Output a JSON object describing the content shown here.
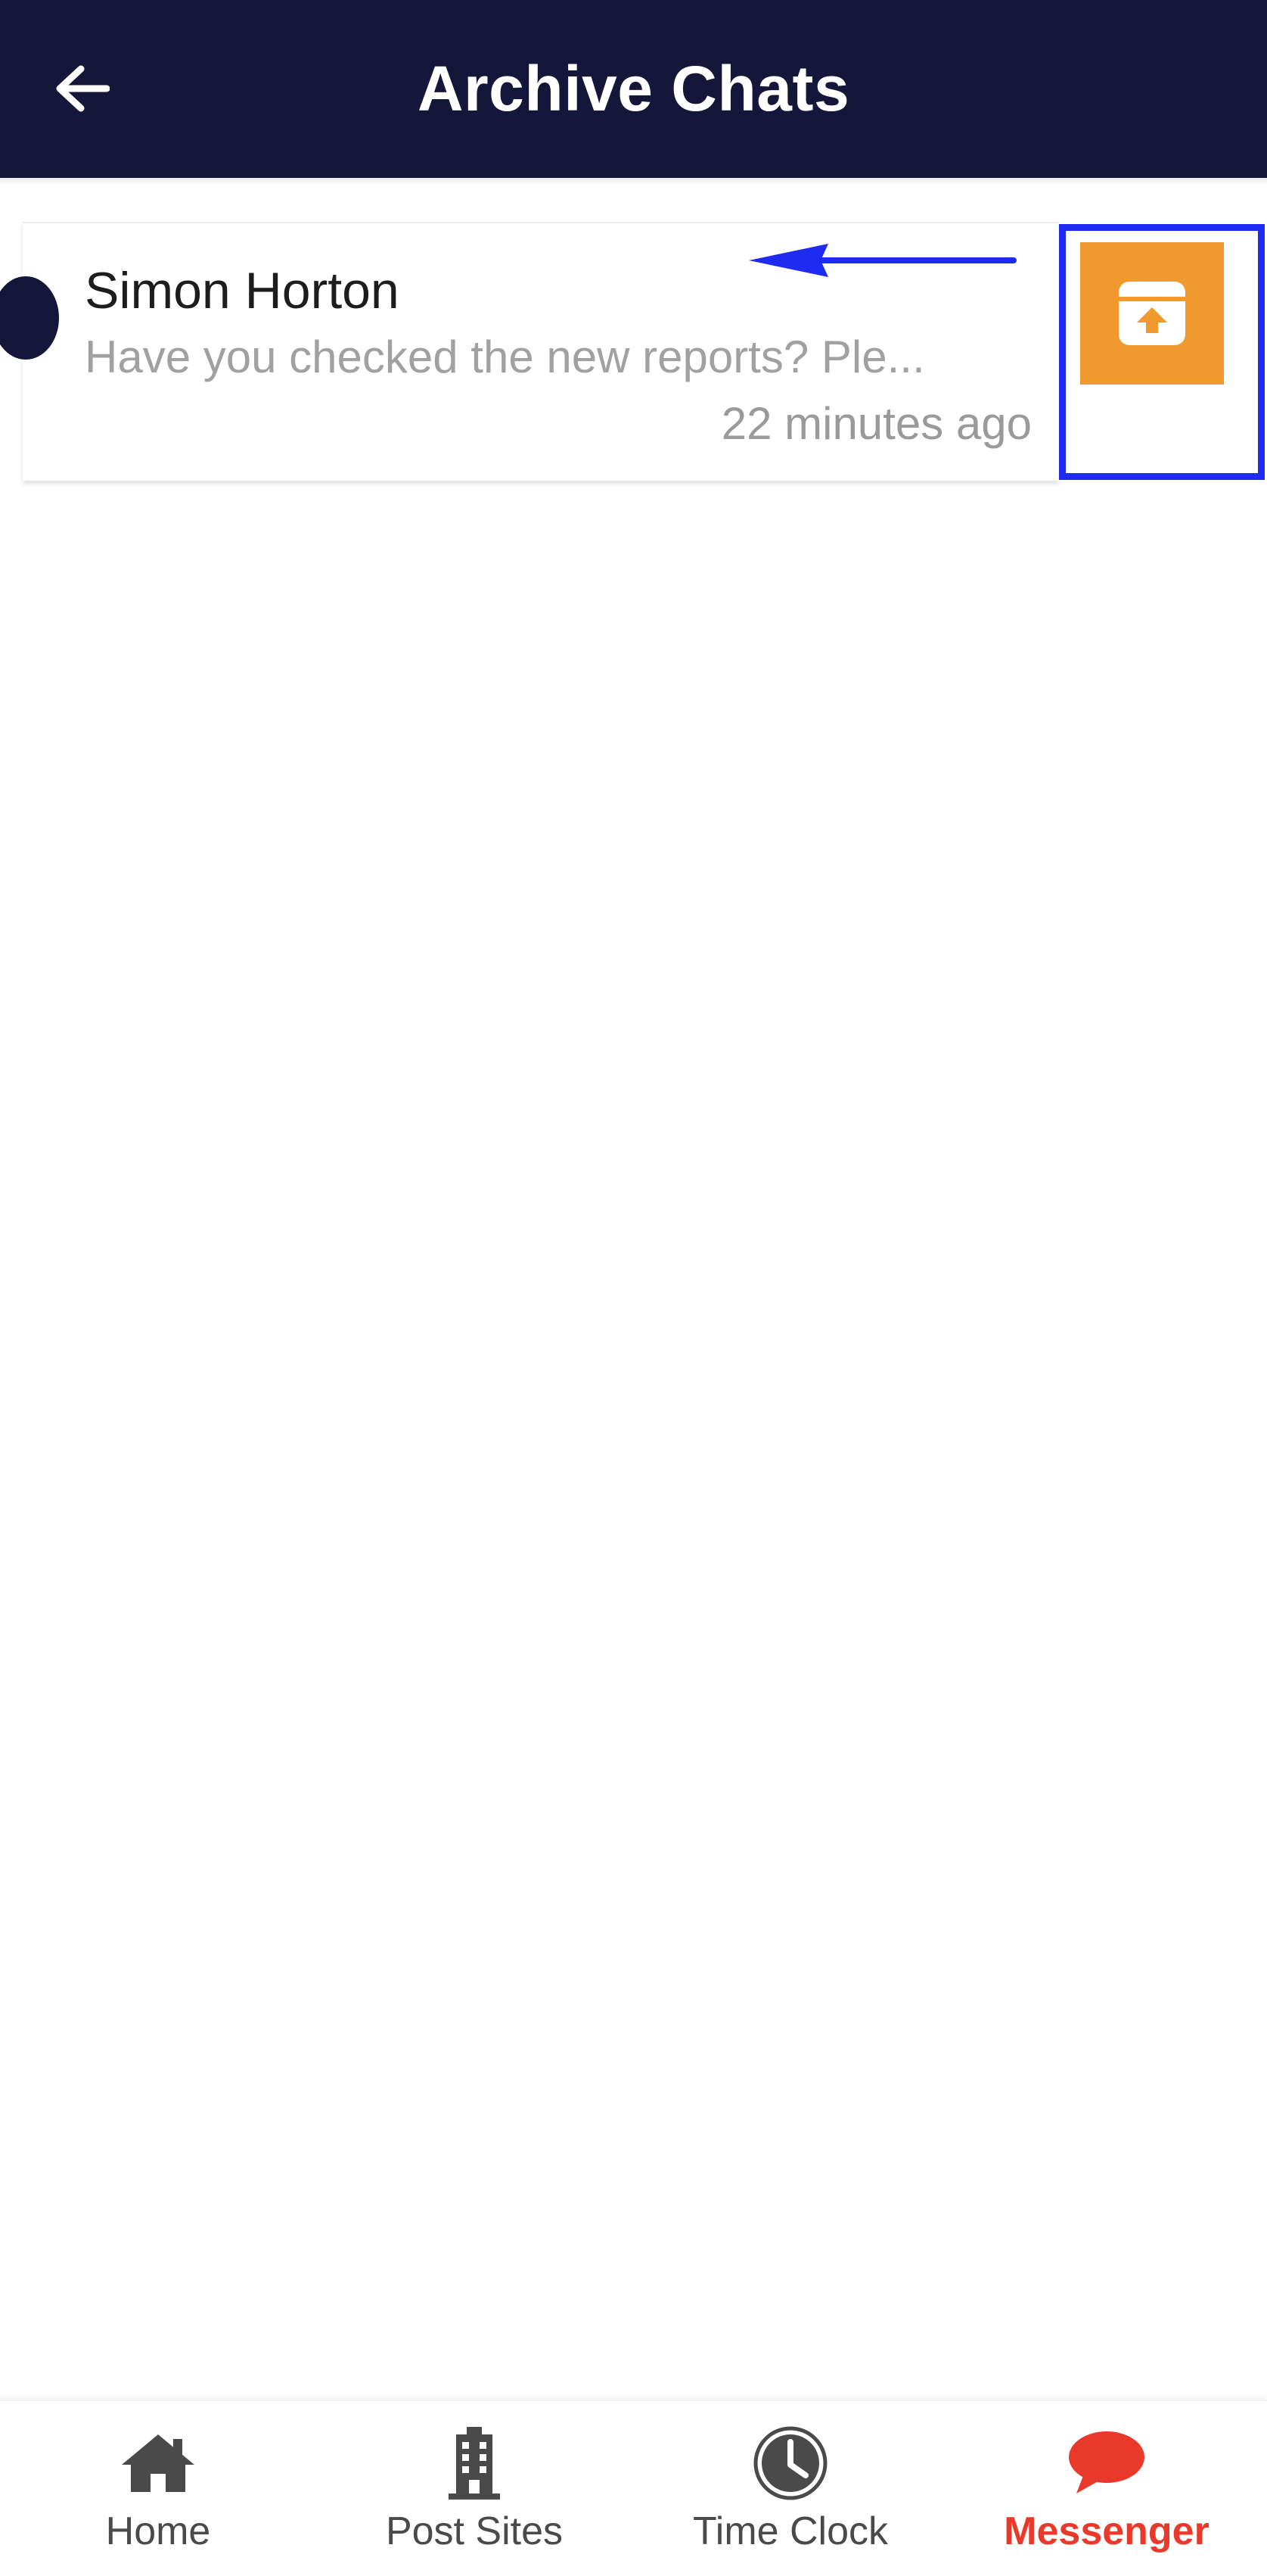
{
  "header": {
    "title": "Archive Chats",
    "back_icon": "arrow-left-icon",
    "background": "#15173a"
  },
  "chats": [
    {
      "name": "Simon Horton",
      "preview": "Have you checked the new reports? Ple...",
      "time": "22 minutes ago"
    }
  ],
  "unarchive_action": {
    "icon": "unarchive-icon",
    "color": "#f0992e",
    "highlight_color": "#1f2bf0"
  },
  "swipe_hint": {
    "icon": "arrow-left-icon",
    "color": "#1f2bf0"
  },
  "bottom_nav": {
    "items": [
      {
        "label": "Home",
        "icon": "home-icon"
      },
      {
        "label": "Post Sites",
        "icon": "building-icon"
      },
      {
        "label": "Time Clock",
        "icon": "clock-icon"
      },
      {
        "label": "Messenger",
        "icon": "chat-bubble-icon",
        "active": true
      }
    ],
    "active_color": "#e8392a"
  }
}
